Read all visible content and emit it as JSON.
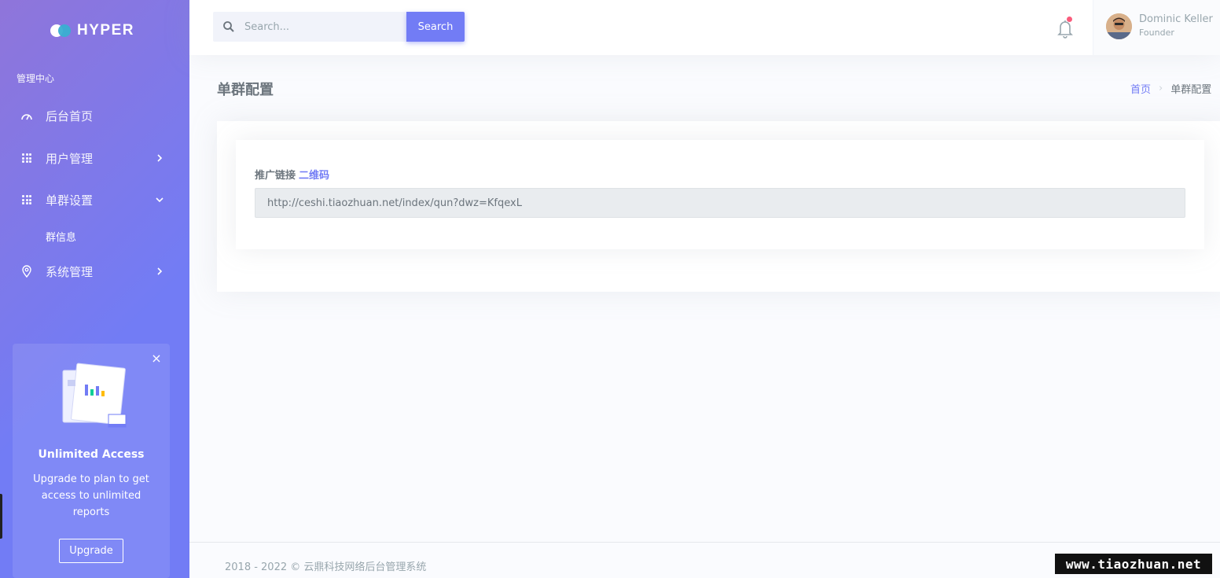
{
  "app": {
    "logo_text": "HYPER"
  },
  "sidebar": {
    "section_title": "管理中心",
    "items": [
      {
        "label": "后台首页",
        "icon": "dashboard-gauge-icon"
      },
      {
        "label": "用户管理",
        "icon": "apps-grid-icon",
        "arrow": "chevron-right-icon"
      },
      {
        "label": "单群设置",
        "icon": "apps-grid-icon",
        "arrow": "chevron-down-icon",
        "expanded": true,
        "children": [
          {
            "label": "群信息"
          }
        ]
      },
      {
        "label": "系统管理",
        "icon": "location-pin-icon",
        "arrow": "chevron-right-icon"
      }
    ],
    "promo": {
      "title": "Unlimited Access",
      "text": "Upgrade to plan to get access to unlimited reports",
      "button": "Upgrade",
      "close_icon": "close-icon"
    }
  },
  "topbar": {
    "search": {
      "placeholder": "Search...",
      "button": "Search"
    },
    "notification": {
      "icon": "bell-icon",
      "has_unread": true
    },
    "user": {
      "name": "Dominic Keller",
      "role": "Founder"
    }
  },
  "page": {
    "title": "单群配置",
    "breadcrumb": [
      {
        "label": "首页"
      },
      {
        "label": "单群配置"
      }
    ],
    "form": {
      "label": "推广链接",
      "qr_link": "二维码",
      "link_value": "http://ceshi.tiaozhuan.net/index/qun?dwz=KfqexL"
    }
  },
  "footer": {
    "text": "2018 - 2022 © 云鼎科技网络后台管理系统"
  },
  "watermark": {
    "text": "www.tiaozhuan.net"
  },
  "colors": {
    "primary": "#727cf5",
    "sidebar_gradient_start": "#8f75da",
    "danger": "#fa5c7c",
    "info": "#39afd1"
  }
}
